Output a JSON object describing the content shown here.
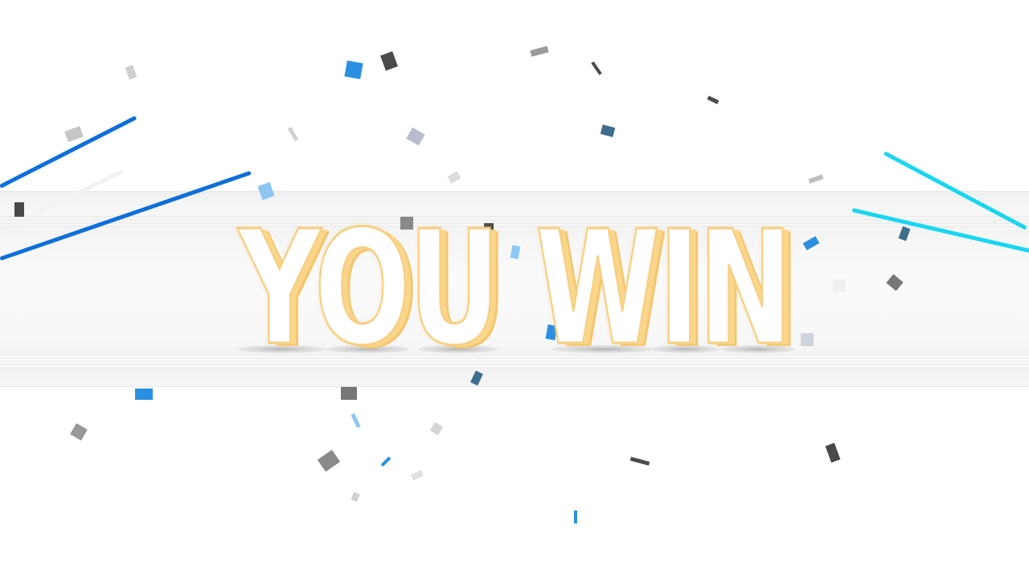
{
  "result": {
    "title": "YOU WIN"
  },
  "colors": {
    "text_fill": "#ffffff",
    "text_outline": "#f7cf84",
    "confetti_blue": "#2a8fe0",
    "confetti_light_blue": "#8cc6f2",
    "confetti_dark": "#4a4a4a",
    "confetti_gray": "#9a9a9a",
    "streak_blue": "#0f6fd8",
    "streak_cyan": "#19d6f0"
  }
}
